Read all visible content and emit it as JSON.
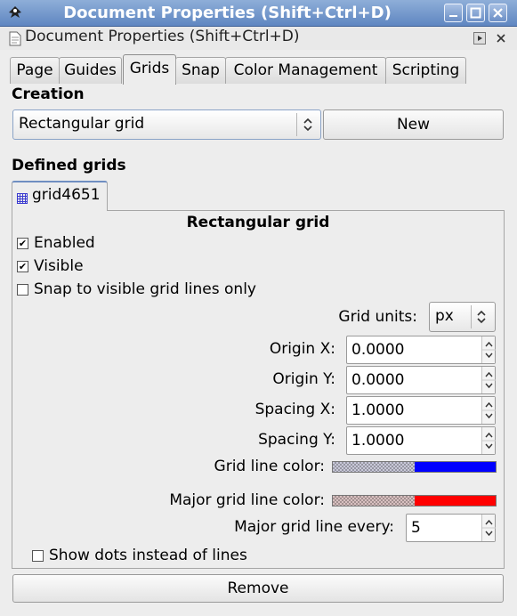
{
  "window": {
    "title": "Document Properties (Shift+Ctrl+D)",
    "controls": [
      "minimize-icon",
      "maximize-icon",
      "close-icon"
    ]
  },
  "dock": {
    "title": "Document Properties (Shift+Ctrl+D)"
  },
  "tabs": [
    {
      "label": "Page",
      "active": false
    },
    {
      "label": "Guides",
      "active": false
    },
    {
      "label": "Grids",
      "active": true
    },
    {
      "label": "Snap",
      "active": false
    },
    {
      "label": "Color Management",
      "active": false
    },
    {
      "label": "Scripting",
      "active": false
    }
  ],
  "creation": {
    "heading": "Creation",
    "grid_type_selected": "Rectangular grid",
    "new_label": "New"
  },
  "defined_grids": {
    "heading": "Defined grids",
    "grid_tab_label": "grid4651",
    "panel_title": "Rectangular grid",
    "enabled_label": "Enabled",
    "enabled_checked": true,
    "visible_label": "Visible",
    "visible_checked": true,
    "snap_visible_label": "Snap to visible grid lines only",
    "snap_visible_checked": false,
    "grid_units_label": "Grid units:",
    "grid_units_value": "px",
    "origin_x_label": "Origin X:",
    "origin_x_value": "0.0000",
    "origin_y_label": "Origin Y:",
    "origin_y_value": "0.0000",
    "spacing_x_label": "Spacing X:",
    "spacing_x_value": "1.0000",
    "spacing_y_label": "Spacing Y:",
    "spacing_y_value": "1.0000",
    "grid_line_color_label": "Grid line color:",
    "grid_line_color": "#0000ff",
    "major_grid_line_color_label": "Major grid line color:",
    "major_grid_line_color": "#ff0000",
    "major_every_label": "Major grid line every:",
    "major_every_value": "5",
    "show_dots_label": "Show dots instead of lines",
    "show_dots_checked": false,
    "remove_label": "Remove"
  },
  "colors": {
    "titlebar_start": "#8eaed8",
    "titlebar_end": "#5f86c1",
    "window_bg": "#ededed",
    "accent": "#6f8ec1"
  }
}
